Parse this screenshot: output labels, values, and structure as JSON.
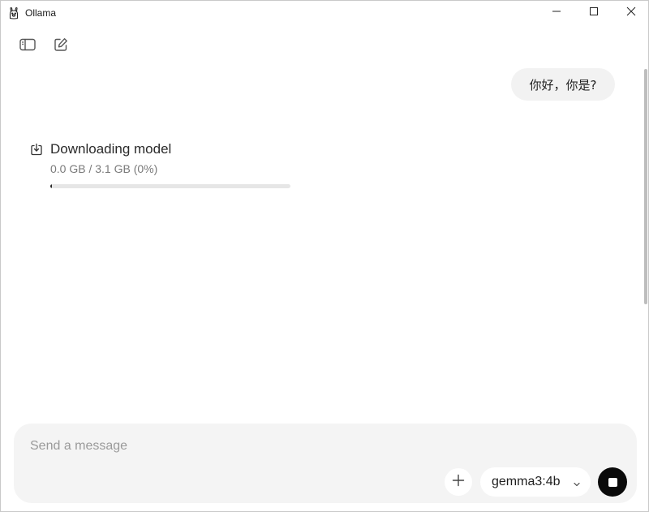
{
  "window": {
    "title": "Ollama",
    "controls": [
      "minimize-icon",
      "maximize-icon",
      "close-icon"
    ]
  },
  "toolbar": {
    "icons": [
      "sidebar-toggle-icon",
      "new-chat-icon"
    ]
  },
  "conversation": {
    "user_message": "你好，你是?",
    "download": {
      "title": "Downloading model",
      "status": "0.0 GB / 3.1 GB (0%)",
      "progress_fraction": 0.0
    }
  },
  "composer": {
    "placeholder": "Send a message",
    "value": "",
    "model": "gemma3:4b",
    "icons": [
      "plus-icon",
      "chevron-down-icon",
      "stop-icon"
    ]
  },
  "colors": {
    "bubble_bg": "#f2f2f2",
    "composer_bg": "#f4f4f4",
    "stop_button": "#0a0a0a",
    "progress_track": "#e6e6e6"
  }
}
